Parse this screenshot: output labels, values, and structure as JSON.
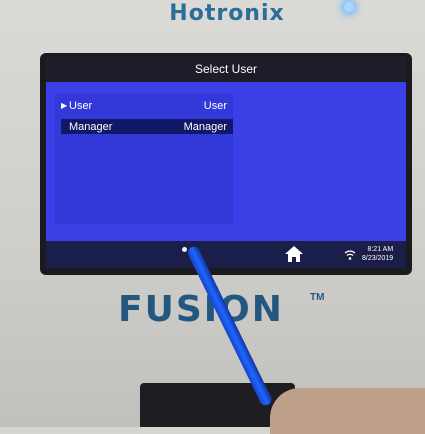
{
  "device": {
    "brand_top": "Hotronix",
    "logo": "FUSION",
    "trademark": "TM"
  },
  "screen": {
    "title": "Select User",
    "users": [
      {
        "name": "User",
        "role": "User",
        "selected": false,
        "marker": "▶"
      },
      {
        "name": "Manager",
        "role": "Manager",
        "selected": true,
        "marker": ""
      }
    ],
    "status": {
      "time": "8:21 AM",
      "date": "8/23/2019"
    }
  },
  "icons": {
    "home": "home-icon",
    "wifi": "wifi-icon"
  },
  "colors": {
    "screen_bg": "#3b3fe6",
    "selected_row": "#121868",
    "titlebar": "#1d1d2a",
    "brand_blue": "#24577f"
  }
}
